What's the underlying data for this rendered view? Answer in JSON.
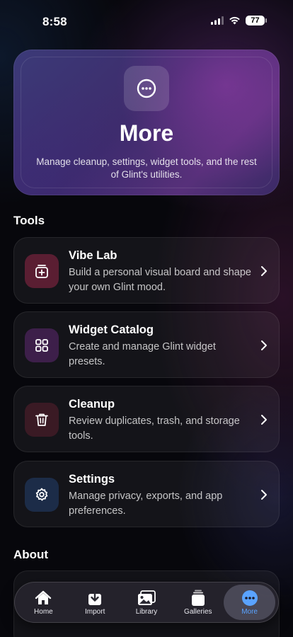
{
  "status_bar": {
    "time": "8:58",
    "battery": "77"
  },
  "hero": {
    "icon": "ellipsis-circle-icon",
    "title": "More",
    "description": "Manage cleanup, settings, widget tools, and the rest of Glint's utilities."
  },
  "sections": {
    "tools": "Tools",
    "about": "About"
  },
  "tools": [
    {
      "title": "Vibe Lab",
      "description": "Build a personal visual board and shape your own Glint mood.",
      "icon": "photo-plus-icon",
      "color": "#5a1e32"
    },
    {
      "title": "Widget Catalog",
      "description": "Create and manage Glint widget presets.",
      "icon": "grid-icon",
      "color": "#3d1f4a"
    },
    {
      "title": "Cleanup",
      "description": "Review duplicates, trash, and storage tools.",
      "icon": "trash-icon",
      "color": "#3a1a24"
    },
    {
      "title": "Settings",
      "description": "Manage privacy, exports, and app preferences.",
      "icon": "gear-icon",
      "color": "#1c2c48"
    }
  ],
  "tab_bar": {
    "tabs": [
      {
        "label": "Home",
        "icon": "home-icon"
      },
      {
        "label": "Import",
        "icon": "import-icon"
      },
      {
        "label": "Library",
        "icon": "photos-icon"
      },
      {
        "label": "Galleries",
        "icon": "galleries-icon"
      },
      {
        "label": "More",
        "icon": "more-icon",
        "active": true
      }
    ],
    "active_color": "#5aa3ff"
  }
}
